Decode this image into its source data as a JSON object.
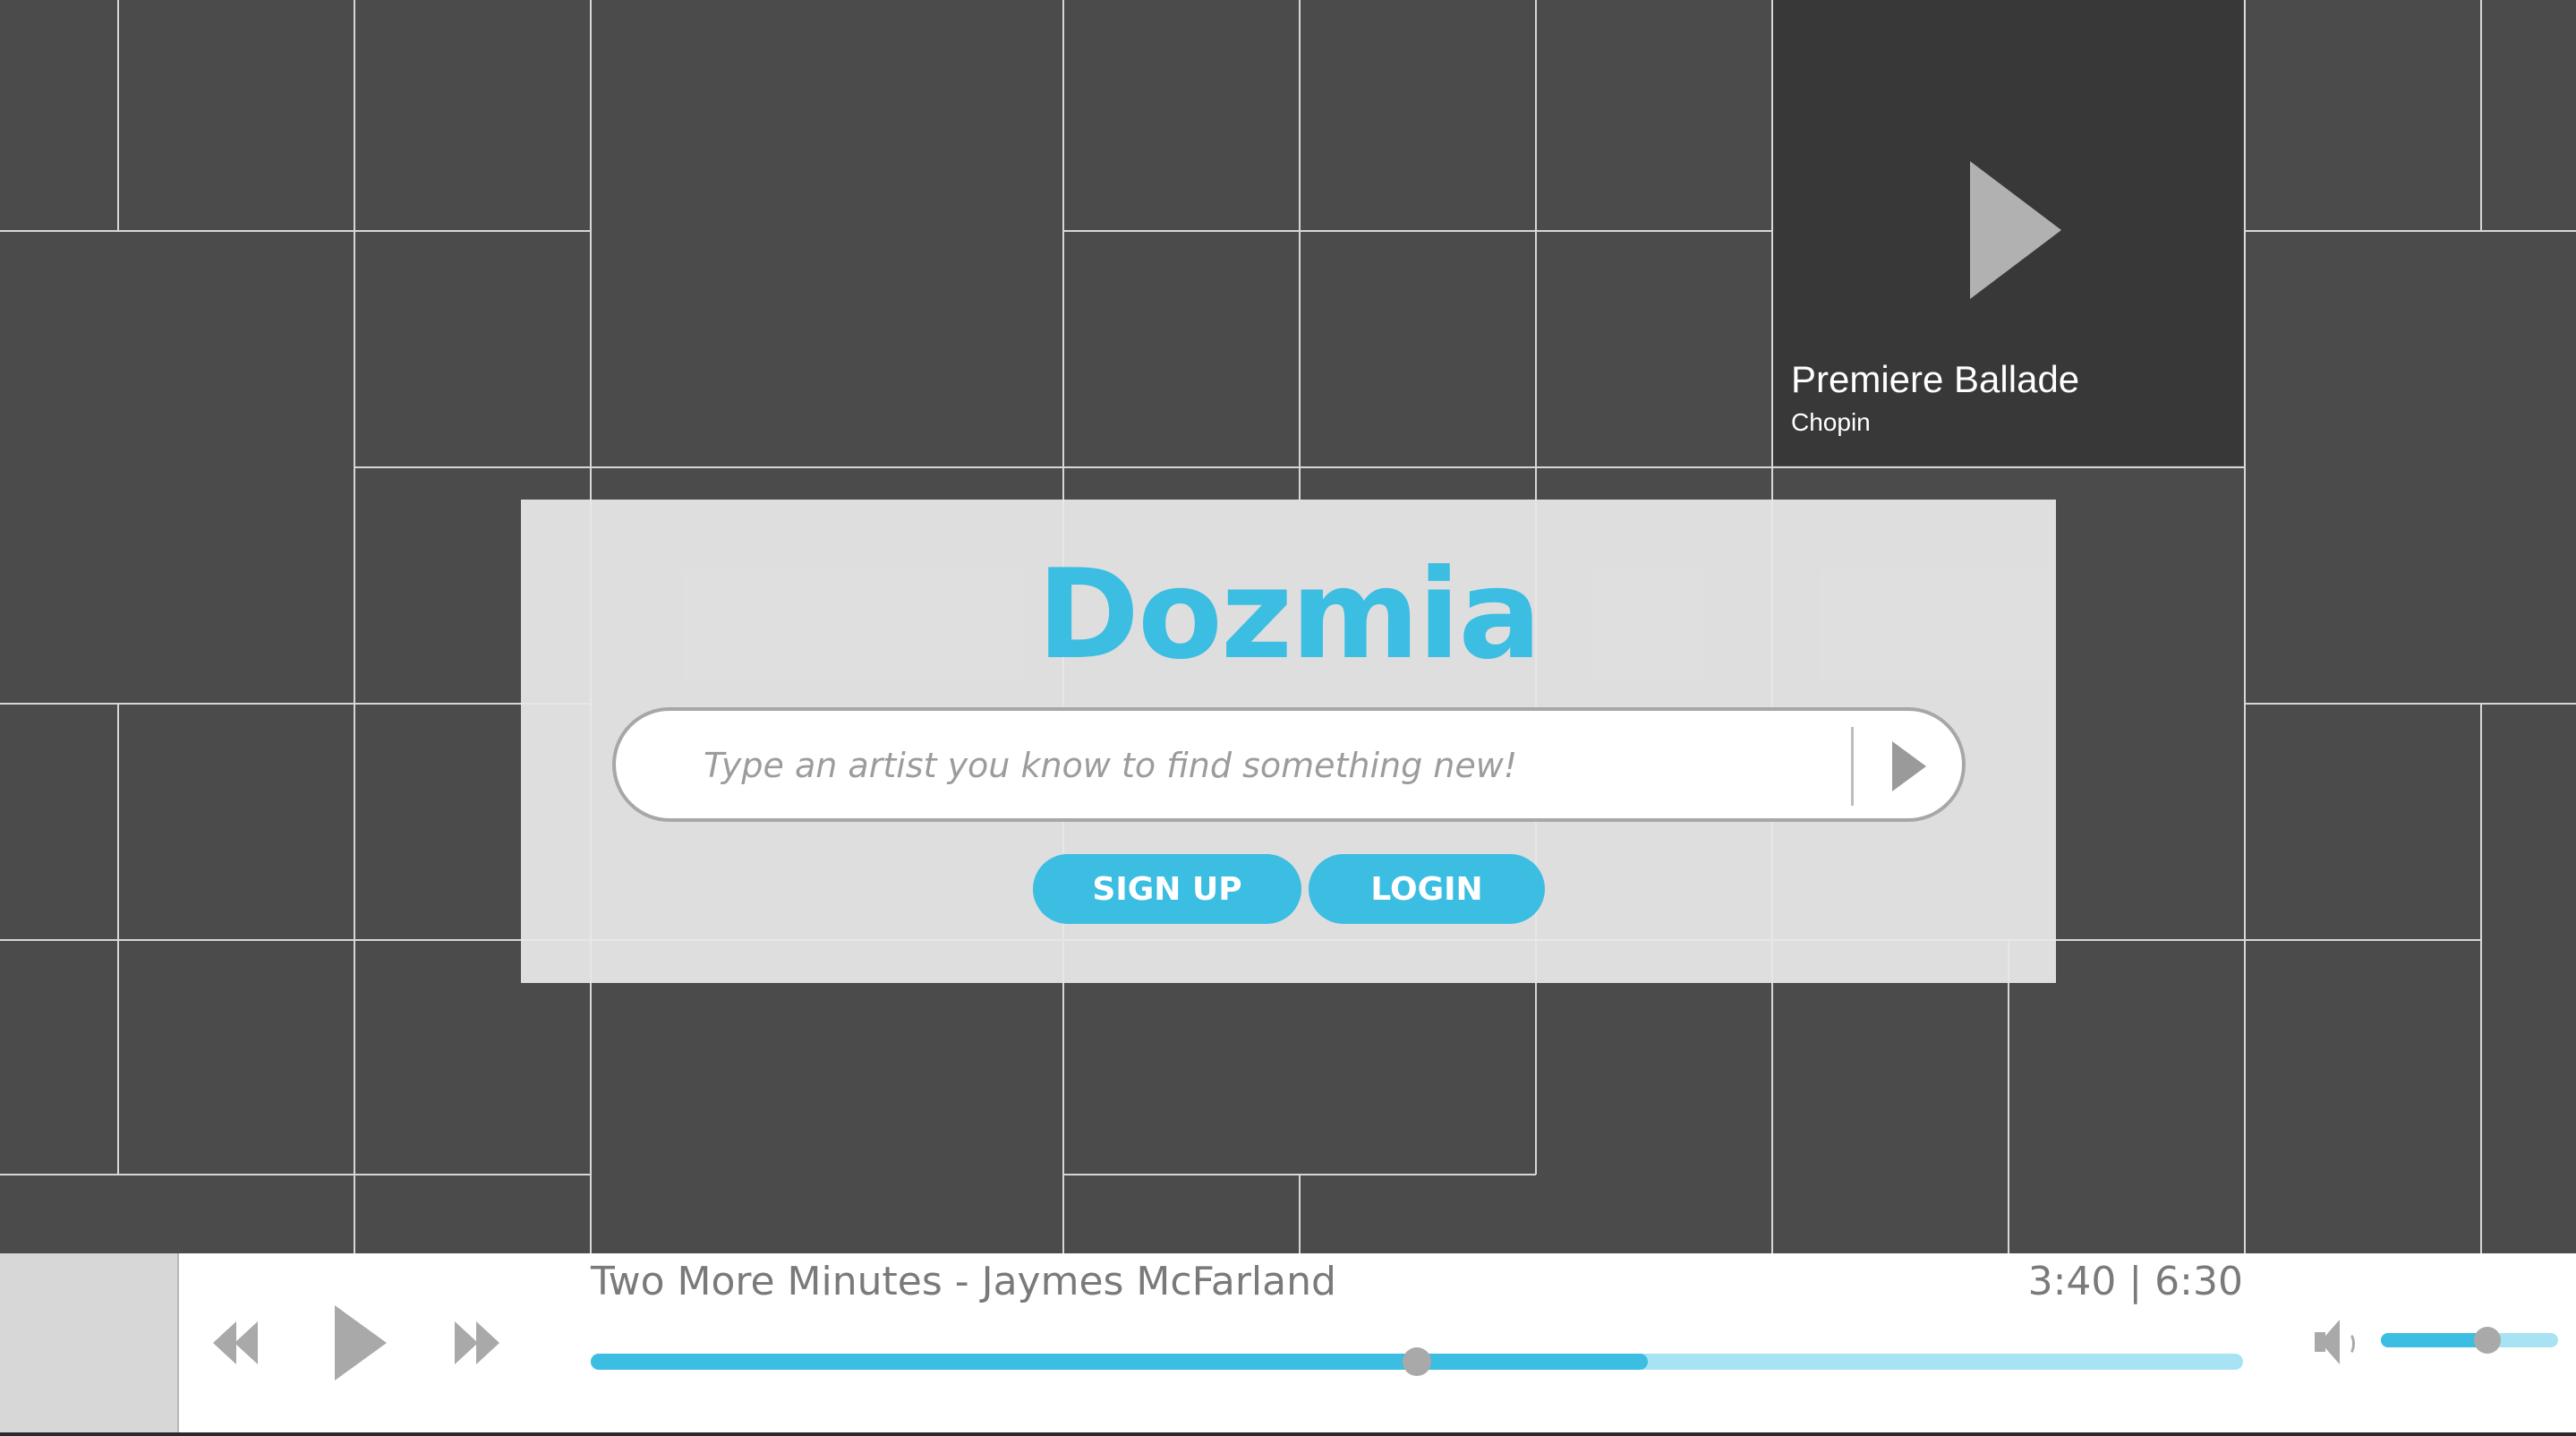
{
  "app": {
    "name": "Dozmia",
    "brand_color": "#3cbde2"
  },
  "featured_tile": {
    "title": "Premiere Ballade",
    "artist": "Chopin",
    "icon": "play-icon"
  },
  "search": {
    "placeholder": "Type an artist you know to find something new!",
    "value": "",
    "submit_icon": "play-arrow-icon"
  },
  "auth": {
    "signup_label": "SIGN UP",
    "login_label": "LOGIN"
  },
  "player": {
    "now_playing": "Two More Minutes - Jaymes McFarland",
    "time_display": "3:40 | 6:30",
    "played_fraction": 0.5,
    "buffered_fraction": 0.64,
    "volume_fraction": 0.6,
    "volume_buffer_fraction": 0.63,
    "icons": [
      "rewind-icon",
      "play-icon",
      "fast-forward-icon",
      "volume-icon"
    ]
  }
}
